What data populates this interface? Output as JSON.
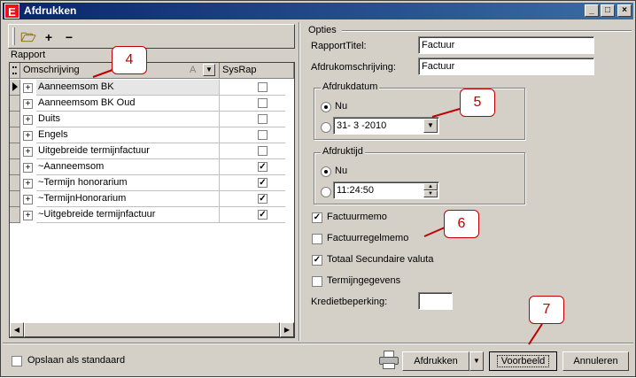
{
  "window": {
    "title": "Afdrukken",
    "app_icon": "E",
    "minimize": "_",
    "maximize": "□",
    "close": "×"
  },
  "toolbar": {
    "open_icon": "🗁",
    "add_icon": "+",
    "remove_icon": "−"
  },
  "rapport": {
    "label": "Rapport",
    "columns": {
      "omschrijving": "Omschrijving",
      "sort_mark": "A",
      "sysrap": "SysRap"
    },
    "rows": [
      {
        "name": "Aanneemsom BK",
        "sysrap": false,
        "current": true
      },
      {
        "name": "Aanneemsom BK Oud",
        "sysrap": false
      },
      {
        "name": "Duits",
        "sysrap": false
      },
      {
        "name": "Engels",
        "sysrap": false
      },
      {
        "name": "Uitgebreide termijnfactuur",
        "sysrap": false
      },
      {
        "name": "~Aanneemsom",
        "sysrap": true
      },
      {
        "name": "~Termijn honorarium",
        "sysrap": true
      },
      {
        "name": "~TermijnHonorarium",
        "sysrap": true
      },
      {
        "name": "~Uitgebreide termijnfactuur",
        "sysrap": true
      }
    ]
  },
  "opties": {
    "label": "Opties",
    "rapporttitel_label": "RapportTitel:",
    "rapporttitel_value": "Factuur",
    "afdrukomschrijving_label": "Afdrukomschrijving:",
    "afdrukomschrijving_value": "Factuur",
    "afdrukdatum": {
      "legend": "Afdrukdatum",
      "now_label": "Nu",
      "date_value": "31- 3 -2010",
      "selected": "now"
    },
    "afdruktijd": {
      "legend": "Afdruktijd",
      "now_label": "Nu",
      "time_value": "11:24:50",
      "selected": "now"
    },
    "checks": [
      {
        "label": "Factuurmemo",
        "checked": true
      },
      {
        "label": "Factuurregelmemo",
        "checked": false
      },
      {
        "label": "Totaal Secundaire valuta",
        "checked": true
      },
      {
        "label": "Termijngegevens",
        "checked": false
      }
    ],
    "kredietbeperking_label": "Kredietbeperking:",
    "kredietbeperking_value": ""
  },
  "footer": {
    "save_default_label": "Opslaan als standaard",
    "print_label": "Afdrukken",
    "preview_label": "Voorbeeld",
    "cancel_label": "Annuleren"
  },
  "callouts": [
    "4",
    "5",
    "6",
    "7"
  ],
  "colors": {
    "callout": "#c00000",
    "title_bar": "#0a246a",
    "face": "#d4d0c8"
  }
}
